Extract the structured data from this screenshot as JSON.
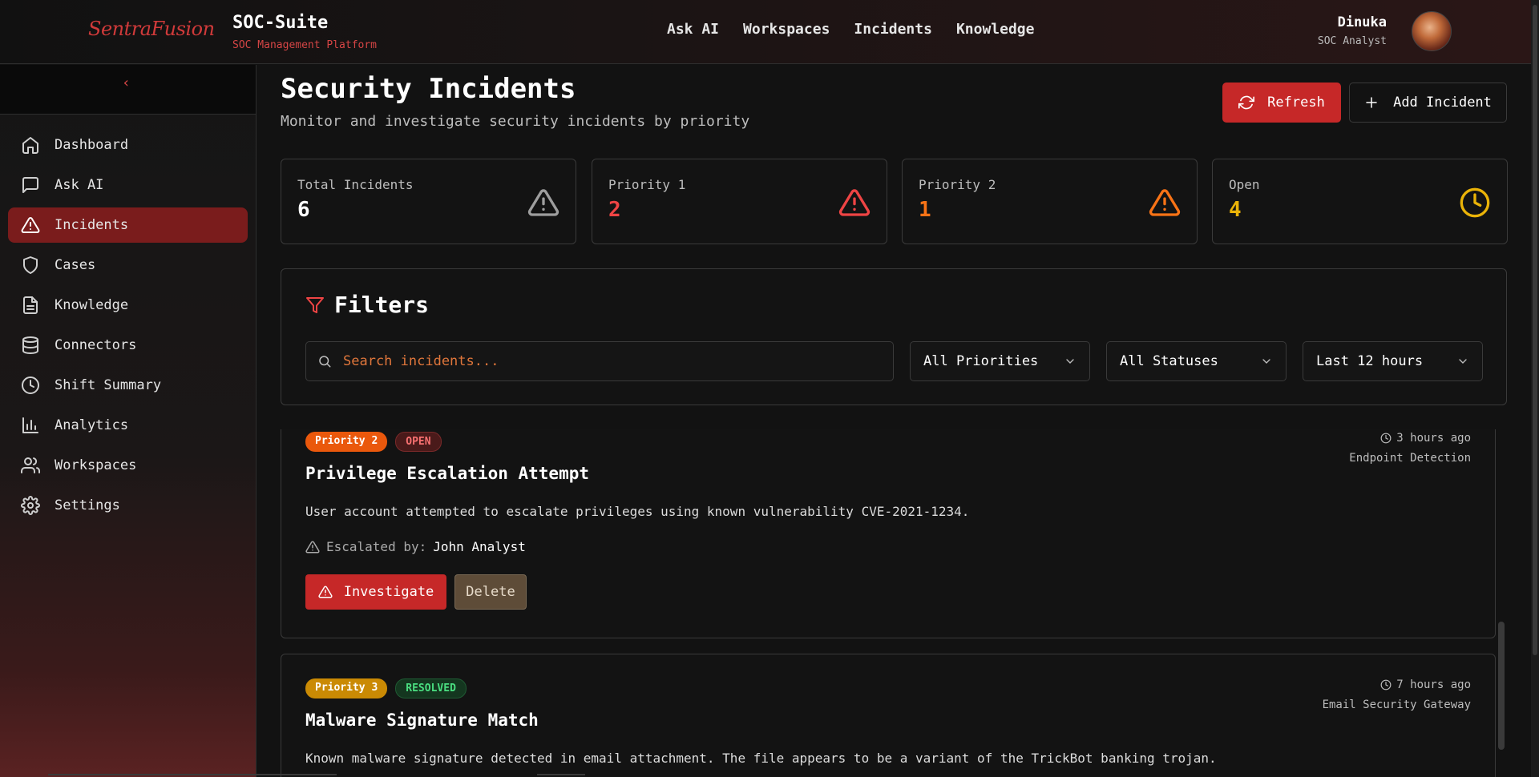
{
  "header": {
    "logo": "SentraFusion",
    "app_title": "SOC-Suite",
    "app_subtitle": "SOC Management Platform",
    "nav": [
      "Ask AI",
      "Workspaces",
      "Incidents",
      "Knowledge"
    ],
    "user": {
      "name": "Dinuka",
      "role": "SOC Analyst"
    }
  },
  "sidebar": {
    "collapse_glyph": "‹",
    "items": [
      {
        "label": "Dashboard",
        "icon": "home-icon",
        "active": false
      },
      {
        "label": "Ask AI",
        "icon": "message-icon",
        "active": false
      },
      {
        "label": "Incidents",
        "icon": "alert-triangle-icon",
        "active": true
      },
      {
        "label": "Cases",
        "icon": "shield-icon",
        "active": false
      },
      {
        "label": "Knowledge",
        "icon": "document-icon",
        "active": false
      },
      {
        "label": "Connectors",
        "icon": "database-icon",
        "active": false
      },
      {
        "label": "Shift Summary",
        "icon": "clock-icon",
        "active": false
      },
      {
        "label": "Analytics",
        "icon": "bar-chart-icon",
        "active": false
      },
      {
        "label": "Workspaces",
        "icon": "users-icon",
        "active": false
      },
      {
        "label": "Settings",
        "icon": "gear-icon",
        "active": false
      }
    ]
  },
  "page": {
    "title": "Security Incidents",
    "subtitle": "Monitor and investigate security incidents by priority",
    "refresh_label": "Refresh",
    "add_label": "Add Incident"
  },
  "stats": [
    {
      "label": "Total Incidents",
      "value": "6",
      "color": "#ffffff",
      "icon_color": "#9e9e9e"
    },
    {
      "label": "Priority 1",
      "value": "2",
      "color": "#ef4444",
      "icon_color": "#ef4444"
    },
    {
      "label": "Priority 2",
      "value": "1",
      "color": "#f97316",
      "icon_color": "#f97316"
    },
    {
      "label": "Open",
      "value": "4",
      "color": "#eab308",
      "icon_color": "#eab308"
    }
  ],
  "filters": {
    "title": "Filters",
    "search_placeholder": "Search incidents...",
    "priority": "All Priorities",
    "status": "All Statuses",
    "time": "Last 12 hours"
  },
  "incidents": [
    {
      "priority": "Priority 2",
      "status": "OPEN",
      "title": "Privilege Escalation Attempt",
      "description": "User account attempted to escalate privileges using known vulnerability CVE-2021-1234.",
      "time": "3 hours ago",
      "source": "Endpoint Detection",
      "escalated_label": "Escalated by:",
      "escalated_by": "John Analyst",
      "investigate_label": "Investigate",
      "delete_label": "Delete"
    },
    {
      "priority": "Priority 3",
      "status": "RESOLVED",
      "title": "Malware Signature Match",
      "description": "Known malware signature detected in email attachment. The file appears to be a variant of the TrickBot banking trojan.",
      "time": "7 hours ago",
      "source": "Email Security Gateway"
    }
  ],
  "colors": {
    "accent": "#c62828",
    "priority2": "#ea580c",
    "priority3": "#ca8a04",
    "open_badge_bg": "#4a1a1a",
    "resolved_badge_bg": "#14361f"
  }
}
